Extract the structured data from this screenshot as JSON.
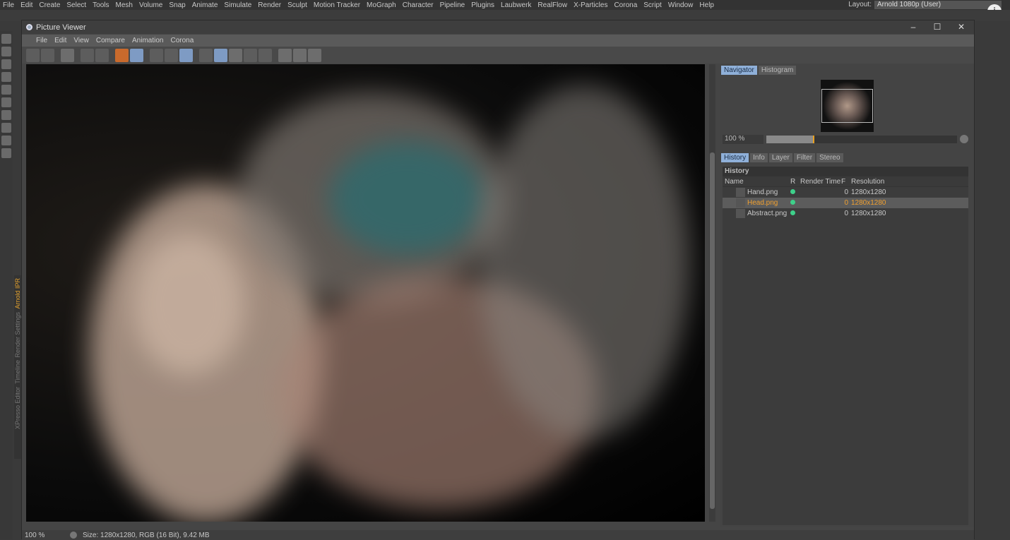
{
  "menubar": {
    "items": [
      "File",
      "Edit",
      "Create",
      "Select",
      "Tools",
      "Mesh",
      "Volume",
      "Snap",
      "Animate",
      "Simulate",
      "Render",
      "Sculpt",
      "Motion Tracker",
      "MoGraph",
      "Character",
      "Pipeline",
      "Plugins",
      "Laubwerk",
      "RealFlow",
      "X-Particles",
      "Corona",
      "Script",
      "Window",
      "Help"
    ],
    "layout_label": "Layout:",
    "layout_value": "Arnold 1080p (User)"
  },
  "side_tabs": [
    "Arnold IPR",
    "Render Settings",
    "Timeline",
    "XPresso Editor"
  ],
  "window": {
    "title": "Picture Viewer",
    "menu": [
      "File",
      "Edit",
      "View",
      "Compare",
      "Animation",
      "Corona"
    ],
    "minimize": "–",
    "maximize": "☐",
    "close": "✕"
  },
  "navigator": {
    "tabs": [
      "Navigator",
      "Histogram"
    ],
    "zoom": "100 %",
    "zoom_fraction": 0.25
  },
  "history": {
    "tabs": [
      "History",
      "Info",
      "Layer",
      "Filter",
      "Stereo"
    ],
    "title": "History",
    "columns": [
      "Name",
      "R",
      "Render Time",
      "F",
      "Resolution"
    ],
    "rows": [
      {
        "name": "Hand.png",
        "f": "0",
        "res": "1280x1280",
        "selected": false
      },
      {
        "name": "Head.png",
        "f": "0",
        "res": "1280x1280",
        "selected": true
      },
      {
        "name": "Abstract.png",
        "f": "0",
        "res": "1280x1280",
        "selected": false
      }
    ]
  },
  "status": {
    "zoom": "100 %",
    "info": "Size: 1280x1280, RGB (16 Bit), 9.42 MB"
  },
  "colors": {
    "accent": "#f0a030",
    "status_green": "#3ed08a",
    "tab_active": "#8fb0d9"
  }
}
